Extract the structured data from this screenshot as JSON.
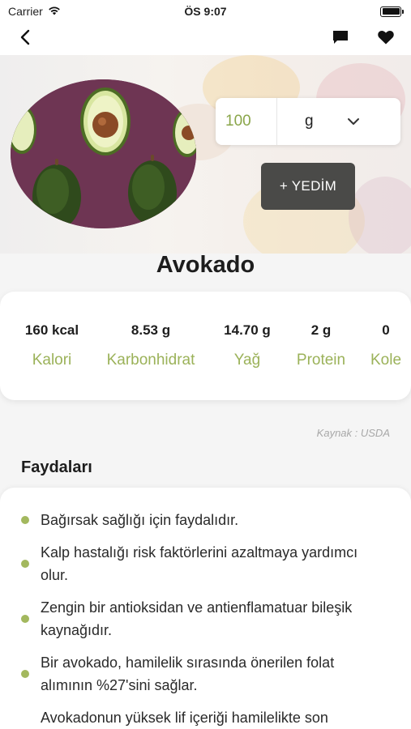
{
  "status_bar": {
    "carrier": "Carrier",
    "time": "ÖS 9:07"
  },
  "nav": {
    "back_icon": "chevron-left-icon",
    "comment_icon": "comment-icon",
    "favorite_icon": "heart-icon"
  },
  "portion": {
    "amount": "100",
    "unit": "g",
    "ate_button": "+ YEDİM"
  },
  "food": {
    "title": "Avokado"
  },
  "nutrition": [
    {
      "value": "160 kcal",
      "label": "Kalori"
    },
    {
      "value": "8.53 g",
      "label": "Karbonhidrat"
    },
    {
      "value": "14.70 g",
      "label": "Yağ"
    },
    {
      "value": "2 g",
      "label": "Protein"
    },
    {
      "value": "0",
      "label": "Kole"
    }
  ],
  "source": "Kaynak : USDA",
  "benefits": {
    "title": "Faydaları",
    "items": [
      "Bağırsak sağlığı için faydalıdır.",
      "Kalp hastalığı risk faktörlerini azaltmaya yardımcı olur.",
      "Zengin bir antioksidan ve antienflamatuar bileşik kaynağıdır.",
      "Bir avokado, hamilelik sırasında önerilen folat alımının %27'sini sağlar.",
      "Avokadonun yüksek lif içeriği hamilelikte son"
    ]
  },
  "colors": {
    "accent_green": "#9bb259",
    "button_dark": "#4a4a48",
    "image_bg": "#6e3553"
  }
}
